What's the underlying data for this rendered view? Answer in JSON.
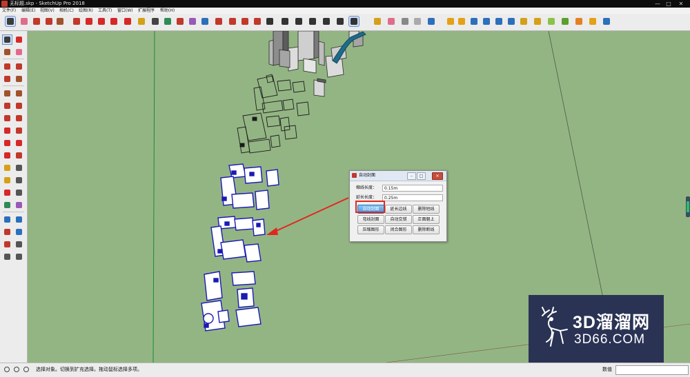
{
  "window": {
    "title": "无标题.skp - SketchUp Pro 2018",
    "controls": [
      "—",
      "□",
      "✕"
    ]
  },
  "menu": [
    "文件(F)",
    "编辑(E)",
    "视图(V)",
    "相机(C)",
    "绘图(R)",
    "工具(T)",
    "窗口(W)",
    "扩展程序",
    "帮助(H)"
  ],
  "toolbar": {
    "icons": [
      {
        "name": "select-arrow-icon",
        "color": "#3c3c3c"
      },
      {
        "name": "eraser-icon",
        "color": "#e06c8c"
      },
      {
        "name": "pencil-line-icon",
        "color": "#c0392b"
      },
      {
        "name": "arc-icon",
        "color": "#c0392b"
      },
      {
        "name": "shape-icon",
        "color": "#a0522d"
      },
      {
        "name": "push-pull-icon",
        "color": "#c0392b"
      },
      {
        "name": "move-icon",
        "color": "#d62828"
      },
      {
        "name": "rotate-icon",
        "color": "#d62828"
      },
      {
        "name": "scale-icon",
        "color": "#d62828"
      },
      {
        "name": "offset-icon",
        "color": "#d62828"
      },
      {
        "name": "tape-measure-icon",
        "color": "#d4a017"
      },
      {
        "name": "text-icon",
        "color": "#444"
      },
      {
        "name": "paint-bucket-icon",
        "color": "#2e8b57"
      },
      {
        "name": "orbit-icon",
        "color": "#c0392b"
      },
      {
        "name": "pan-icon",
        "color": "#9b59b6"
      },
      {
        "name": "zoom-icon",
        "color": "#2c6fbb"
      },
      {
        "name": "zoom-extents-icon",
        "color": "#c0392b"
      },
      {
        "name": "warehouse-icon",
        "color": "#c0392b"
      },
      {
        "name": "extension-warehouse-icon",
        "color": "#c0392b"
      },
      {
        "name": "layout-icon",
        "color": "#c0392b"
      },
      {
        "name": "iso-view-icon",
        "color": "#333"
      },
      {
        "name": "top-view-icon",
        "color": "#333"
      },
      {
        "name": "front-view-icon",
        "color": "#333"
      },
      {
        "name": "right-view-icon",
        "color": "#333"
      },
      {
        "name": "back-view-icon",
        "color": "#333"
      },
      {
        "name": "left-view-icon",
        "color": "#333"
      },
      {
        "name": "cursor-icon",
        "color": "#333"
      },
      {
        "name": "section-plane-icon",
        "color": "#d4a017"
      },
      {
        "name": "eraser-alt-icon",
        "color": "#e06c8c"
      },
      {
        "name": "xray-icon",
        "color": "#888"
      },
      {
        "name": "shadow-icon",
        "color": "#aaa"
      },
      {
        "name": "sort-icon",
        "color": "#2c6fbb"
      },
      {
        "name": "ruby-m-icon",
        "color": "#e6a017"
      },
      {
        "name": "ruby-tag-icon",
        "color": "#e6a017"
      },
      {
        "name": "ruby-r-icon",
        "color": "#2c6fbb"
      },
      {
        "name": "ruby-rt-icon",
        "color": "#2c6fbb"
      },
      {
        "name": "ruby-rb-icon",
        "color": "#2c6fbb"
      },
      {
        "name": "ruby-help-icon",
        "color": "#2c6fbb"
      },
      {
        "name": "ruby-gem-icon",
        "color": "#d4a017"
      },
      {
        "name": "ruby-gold-icon",
        "color": "#d4a017"
      },
      {
        "name": "ruby-spark-icon",
        "color": "#8bc34a"
      },
      {
        "name": "ruby-leaf-icon",
        "color": "#5aa02c"
      },
      {
        "name": "ruby-orange-icon",
        "color": "#e67e22"
      },
      {
        "name": "ruby-dot-icon",
        "color": "#e6a017"
      },
      {
        "name": "ruby-grid-icon",
        "color": "#2c6fbb"
      }
    ]
  },
  "leftToolbar": {
    "icons": [
      "select-icon",
      "make-component-icon",
      "paint-bucket-icon",
      "eraser-icon",
      "line-icon",
      "freehand-icon",
      "rectangle-icon",
      "rotated-rectangle-icon",
      "circle-icon",
      "polygon-icon",
      "arc-icon",
      "two-point-arc-icon",
      "three-point-arc-icon",
      "pie-icon",
      "move-icon",
      "push-pull-icon",
      "rotate-icon",
      "follow-me-icon",
      "scale-icon",
      "offset-icon",
      "tape-measure-icon",
      "dimension-icon",
      "protractor-icon",
      "text-icon",
      "axes-icon",
      "3d-text-icon",
      "orbit-icon",
      "pan-icon",
      "zoom-icon",
      "zoom-window-icon",
      "zoom-extents-icon",
      "previous-view-icon",
      "position-camera-icon",
      "look-around-icon",
      "walk-icon",
      "section-plane-icon"
    ]
  },
  "dialog": {
    "title": "自动封面",
    "fields": [
      {
        "label": "缩线长度：",
        "value": "0.15m"
      },
      {
        "label": "延长长度：",
        "value": "0.25m"
      }
    ],
    "buttons": [
      [
        "自动封面",
        "延长边线",
        "删除短线"
      ],
      [
        "弯线封面",
        "自动交错",
        "正面朝上"
      ],
      [
        "压缩图形",
        "闭合图形",
        "删除断线"
      ]
    ]
  },
  "statusbar": {
    "text": "选择对象。切换到扩充选择。拖动鼠标选择多项。",
    "measurements_label": "数值",
    "measurements_value": ""
  },
  "watermark": {
    "line1": "3D溜溜网",
    "line2": "3D66.COM"
  },
  "colors": {
    "viewport": "#93b584",
    "selection": "#1a1ab4",
    "highlight": "#e0281e"
  }
}
